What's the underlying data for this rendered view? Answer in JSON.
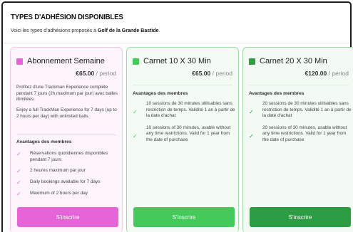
{
  "header": {
    "title": "TYPES D'ADHÉSION DISPONIBLES",
    "subtitle_prefix": "Voici les types d'adhésions proposés à ",
    "club_name": "Golf de la Grande Bastide",
    "subtitle_suffix": "."
  },
  "colors": {
    "pink": "#e565d9",
    "green": "#45c95a",
    "dark_green": "#2c9d43"
  },
  "plans": [
    {
      "name": "Abonnement Semaine",
      "price": "€65.00",
      "period": "/ period",
      "descriptions": [
        "Profitez d'une Trackman Experience complète pendant 7 jours (2h maximum par jour) avec balles illimitées.",
        "Enjoy a full TrackMan Experience for 7 days (up to 2 hours per day) with unlimited balls."
      ],
      "benefits_title": "Avantages des membres",
      "benefits": [
        "Réservations quotidiennes disponibles pendant 7 jours",
        "2 heures maximum par jour",
        "Daily bookings available for 7 days",
        "Maximum of 2 hours per day"
      ],
      "button": "S'inscrire"
    },
    {
      "name": "Carnet 10 X 30 Min",
      "price": "€65.00",
      "period": "/ period",
      "benefits_title": "Avantages des membres",
      "benefits": [
        "10 sessions de 30 minutes utilisables sans restriction de temps. Validité 1 an à partir de la date d'achat",
        "10 sessions of 30 minutes, usable without any time restrictions. Valid for 1 year from the date of purchase"
      ],
      "button": "S'inscrire"
    },
    {
      "name": "Carnet 20 X 30 Min",
      "price": "€120.00",
      "period": "/ period",
      "benefits_title": "Avantages des membres",
      "benefits": [
        "20 sessions de 30 minutes utilisables sans restriction de temps. Validité 1 an à partir de la date d'achat",
        "20 sessions of 30 minutes, usable without any time restrictions. Valid for 1 year from the date of purchase"
      ],
      "button": "S'inscrire"
    }
  ]
}
